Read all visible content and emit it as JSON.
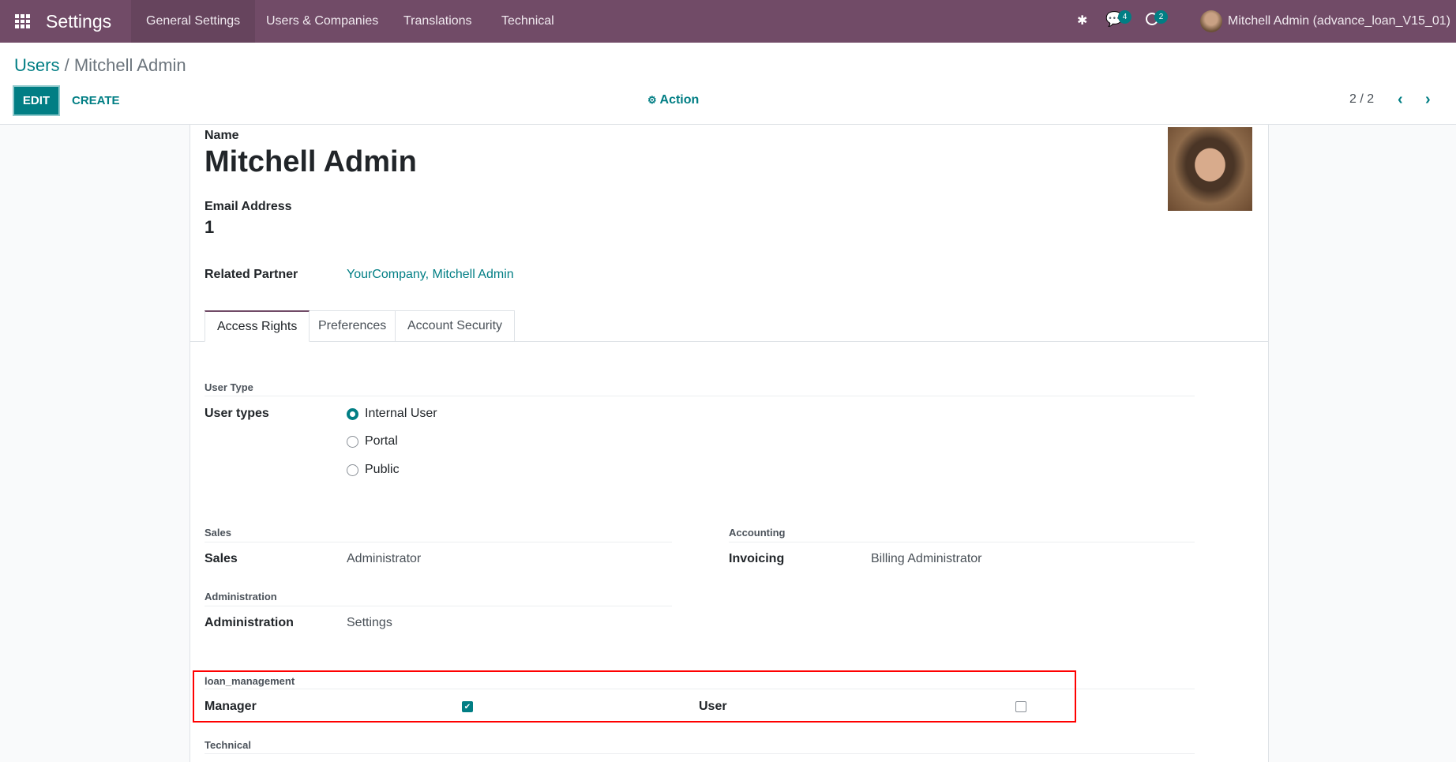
{
  "navbar": {
    "app_title": "Settings",
    "menu": [
      "General Settings",
      "Users & Companies",
      "Translations",
      "Technical"
    ],
    "messages_count": "4",
    "activities_count": "2",
    "user": "Mitchell Admin (advance_loan_V15_01)"
  },
  "breadcrumb": {
    "parent": "Users",
    "separator": "/",
    "current": "Mitchell Admin"
  },
  "control_panel": {
    "edit": "EDIT",
    "create": "CREATE",
    "action": "Action",
    "pager": "2 / 2"
  },
  "form": {
    "name_label": "Name",
    "name": "Mitchell Admin",
    "email_label": "Email Address",
    "email": "1",
    "related_partner_label": "Related Partner",
    "related_partner": "YourCompany, Mitchell Admin",
    "tabs": [
      "Access Rights",
      "Preferences",
      "Account Security"
    ],
    "user_type_section": "User Type",
    "user_types_label": "User types",
    "user_types": [
      {
        "label": "Internal User",
        "selected": true
      },
      {
        "label": "Portal",
        "selected": false
      },
      {
        "label": "Public",
        "selected": false
      }
    ],
    "sales_section": "Sales",
    "sales_label": "Sales",
    "sales_value": "Administrator",
    "accounting_section": "Accounting",
    "invoicing_label": "Invoicing",
    "invoicing_value": "Billing Administrator",
    "administration_section": "Administration",
    "administration_label": "Administration",
    "administration_value": "Settings",
    "loan_section": "loan_management",
    "loan_manager_label": "Manager",
    "loan_manager_checked": true,
    "loan_user_label": "User",
    "loan_user_checked": false,
    "technical_section": "Technical"
  },
  "colors": {
    "brand": "#714b67",
    "accent": "#017e84",
    "highlight_box": "#ff0000"
  }
}
